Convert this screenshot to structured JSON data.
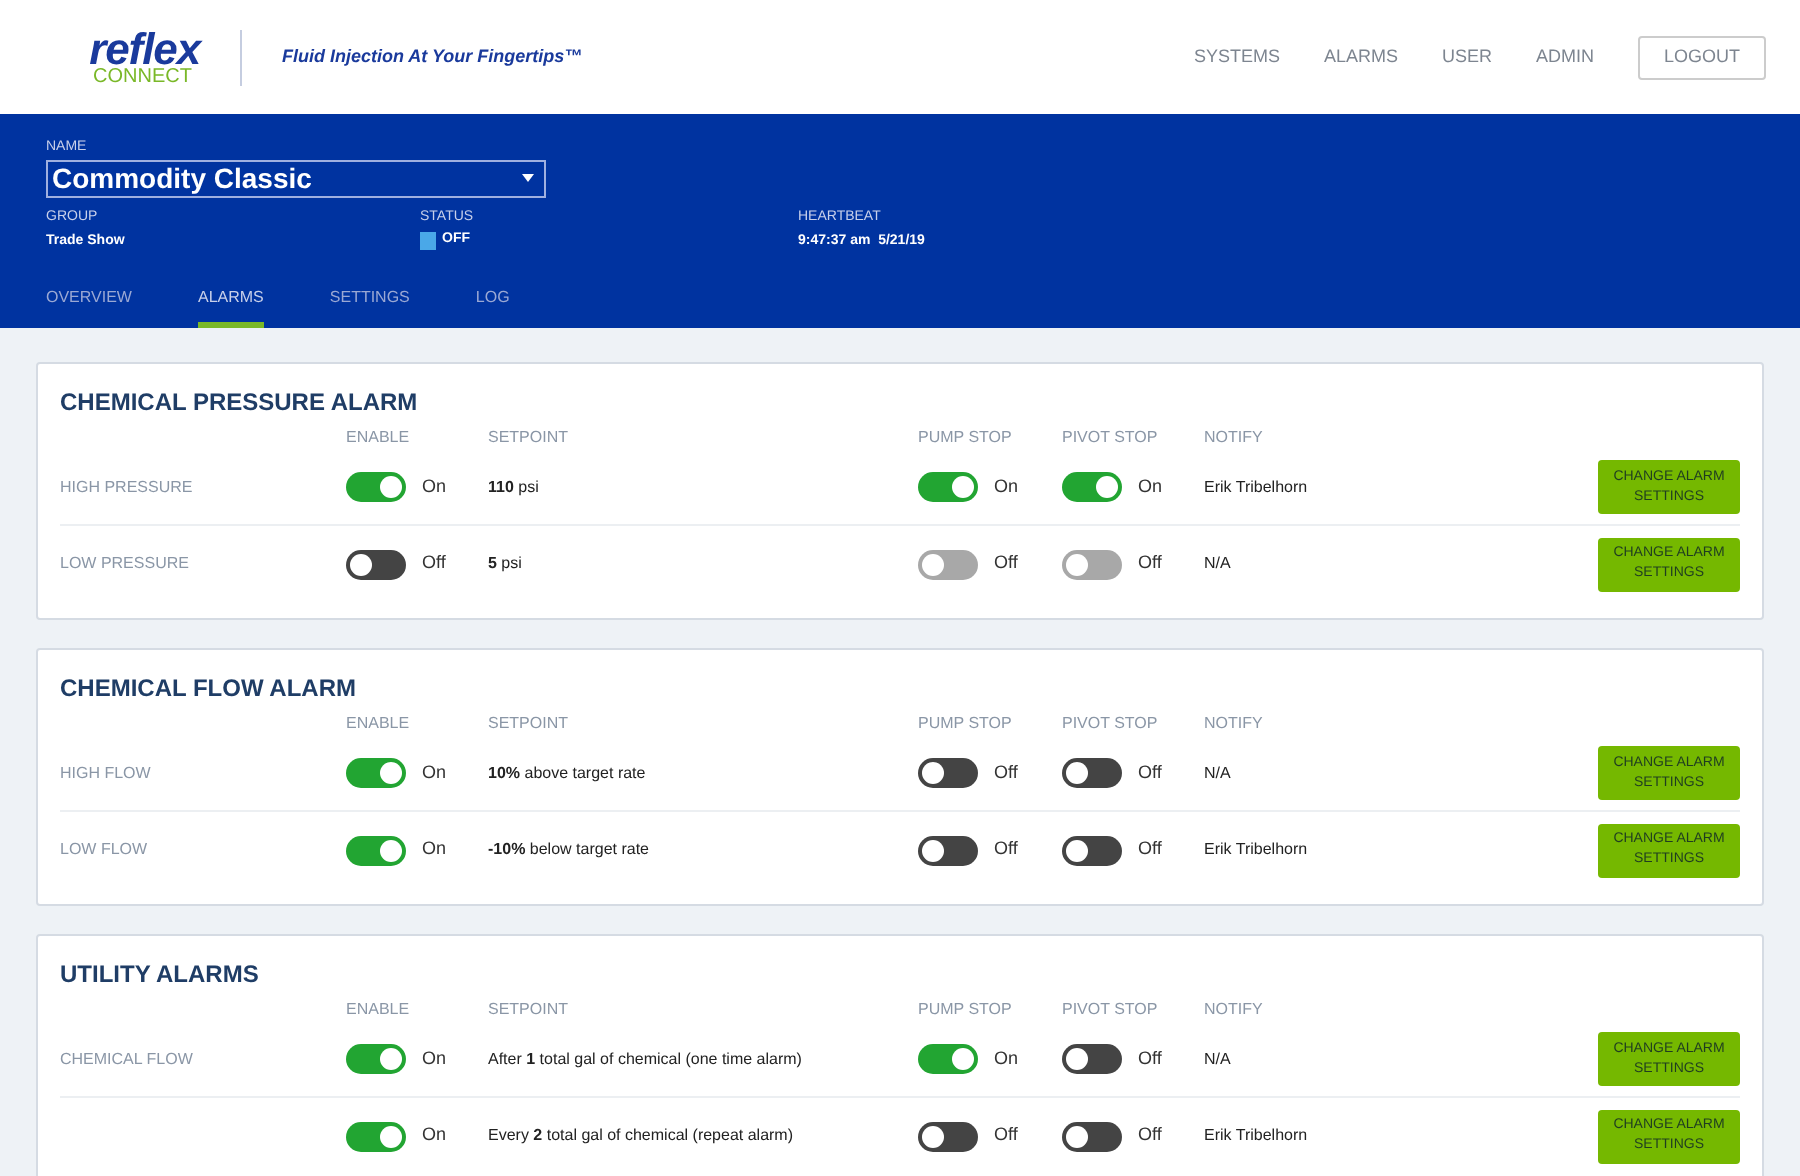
{
  "header": {
    "logo_word": "reflex",
    "logo_sub": "CONNECT",
    "tagline": "Fluid Injection At Your Fingertips™",
    "nav": [
      "SYSTEMS",
      "ALARMS",
      "USER",
      "ADMIN"
    ],
    "logout": "LOGOUT"
  },
  "system": {
    "name_label": "NAME",
    "name": "Commodity Classic",
    "group_label": "GROUP",
    "group": "Trade Show",
    "status_label": "STATUS",
    "status": "OFF",
    "heartbeat_label": "HEARTBEAT",
    "heartbeat": "9:47:37 am  5/21/19"
  },
  "tabs": [
    {
      "label": "OVERVIEW",
      "selected": false
    },
    {
      "label": "ALARMS",
      "selected": true
    },
    {
      "label": "SETTINGS",
      "selected": false
    },
    {
      "label": "LOG",
      "selected": false
    }
  ],
  "sections": [
    {
      "title": "CHEMICAL PRESSURE ALARM",
      "columns": [
        "ENABLE",
        "SETPOINT",
        "PUMP STOP",
        "PIVOT STOP",
        "NOTIFY"
      ],
      "rows": [
        {
          "label": "HIGH PRESSURE",
          "enable": {
            "on": true,
            "disabled": false,
            "text": "On"
          },
          "setpoint": "**110** psi",
          "pump_stop": {
            "on": true,
            "disabled": false,
            "text": "On"
          },
          "pivot_stop": {
            "on": true,
            "disabled": false,
            "text": "On"
          },
          "notify": "Erik Tribelhorn",
          "button": "CHANGE ALARM SETTINGS"
        },
        {
          "label": "LOW PRESSURE",
          "enable": {
            "on": false,
            "disabled": false,
            "text": "Off"
          },
          "setpoint": "**5** psi",
          "pump_stop": {
            "on": false,
            "disabled": true,
            "text": "Off"
          },
          "pivot_stop": {
            "on": false,
            "disabled": true,
            "text": "Off"
          },
          "notify": "N/A",
          "button": "CHANGE ALARM SETTINGS"
        }
      ]
    },
    {
      "title": "CHEMICAL FLOW ALARM",
      "columns": [
        "ENABLE",
        "SETPOINT",
        "PUMP STOP",
        "PIVOT STOP",
        "NOTIFY"
      ],
      "rows": [
        {
          "label": "HIGH FLOW",
          "enable": {
            "on": true,
            "disabled": false,
            "text": "On"
          },
          "setpoint": "**10%** above target rate",
          "pump_stop": {
            "on": false,
            "disabled": false,
            "text": "Off"
          },
          "pivot_stop": {
            "on": false,
            "disabled": false,
            "text": "Off"
          },
          "notify": "N/A",
          "button": "CHANGE ALARM SETTINGS"
        },
        {
          "label": "LOW FLOW",
          "enable": {
            "on": true,
            "disabled": false,
            "text": "On"
          },
          "setpoint": "**-10%** below target rate",
          "pump_stop": {
            "on": false,
            "disabled": false,
            "text": "Off"
          },
          "pivot_stop": {
            "on": false,
            "disabled": false,
            "text": "Off"
          },
          "notify": "Erik Tribelhorn",
          "button": "CHANGE ALARM SETTINGS"
        }
      ]
    },
    {
      "title": "UTILITY ALARMS",
      "columns": [
        "ENABLE",
        "SETPOINT",
        "PUMP STOP",
        "PIVOT STOP",
        "NOTIFY"
      ],
      "rows": [
        {
          "label": "CHEMICAL FLOW",
          "enable": {
            "on": true,
            "disabled": false,
            "text": "On"
          },
          "setpoint": "After **1** total gal of chemical (one time alarm)",
          "pump_stop": {
            "on": true,
            "disabled": false,
            "text": "On"
          },
          "pivot_stop": {
            "on": false,
            "disabled": false,
            "text": "Off"
          },
          "notify": "N/A",
          "button": "CHANGE ALARM SETTINGS"
        },
        {
          "enable": {
            "on": true,
            "disabled": false,
            "text": "On"
          },
          "setpoint": "Every **2** total gal of chemical (repeat alarm)",
          "pump_stop": {
            "on": false,
            "disabled": false,
            "text": "Off"
          },
          "pivot_stop": {
            "on": false,
            "disabled": false,
            "text": "Off"
          },
          "notify": "Erik Tribelhorn",
          "button": "CHANGE ALARM SETTINGS"
        }
      ]
    }
  ]
}
